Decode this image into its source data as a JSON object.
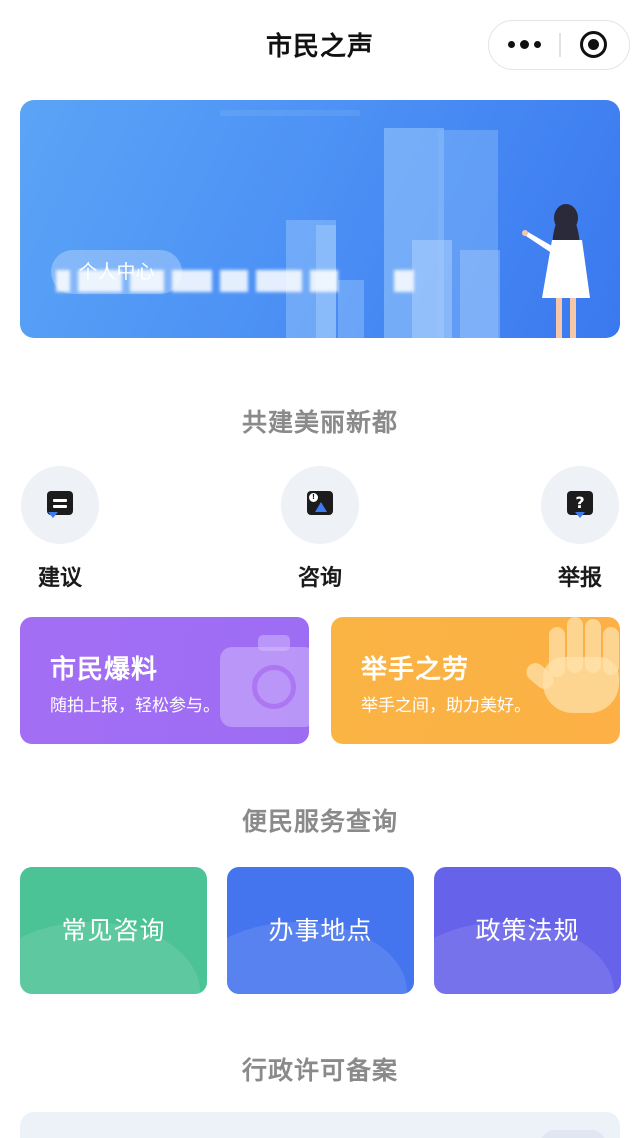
{
  "header": {
    "title": "市民之声"
  },
  "banner": {
    "personal_center": "个人中心"
  },
  "sections": {
    "build": "共建美丽新都",
    "service": "便民服务查询",
    "permit": "行政许可备案"
  },
  "actions": [
    {
      "label": "建议",
      "icon": "suggestion-icon"
    },
    {
      "label": "咨询",
      "icon": "consult-icon"
    },
    {
      "label": "举报",
      "icon": "report-icon"
    }
  ],
  "features": [
    {
      "title": "市民爆料",
      "subtitle": "随拍上报，轻松参与。",
      "icon": "camera-icon",
      "color": "#a36ef4"
    },
    {
      "title": "举手之劳",
      "subtitle": "举手之间，助力美好。",
      "icon": "hand-icon",
      "color": "#fcb045"
    }
  ],
  "services": [
    {
      "label": "常见咨询",
      "color": "#4cc396"
    },
    {
      "label": "办事地点",
      "color": "#4574ef"
    },
    {
      "label": "政策法规",
      "color": "#6762ea"
    }
  ],
  "colors": {
    "banner": "#4d92f5",
    "section_title": "#8a8a8a"
  }
}
